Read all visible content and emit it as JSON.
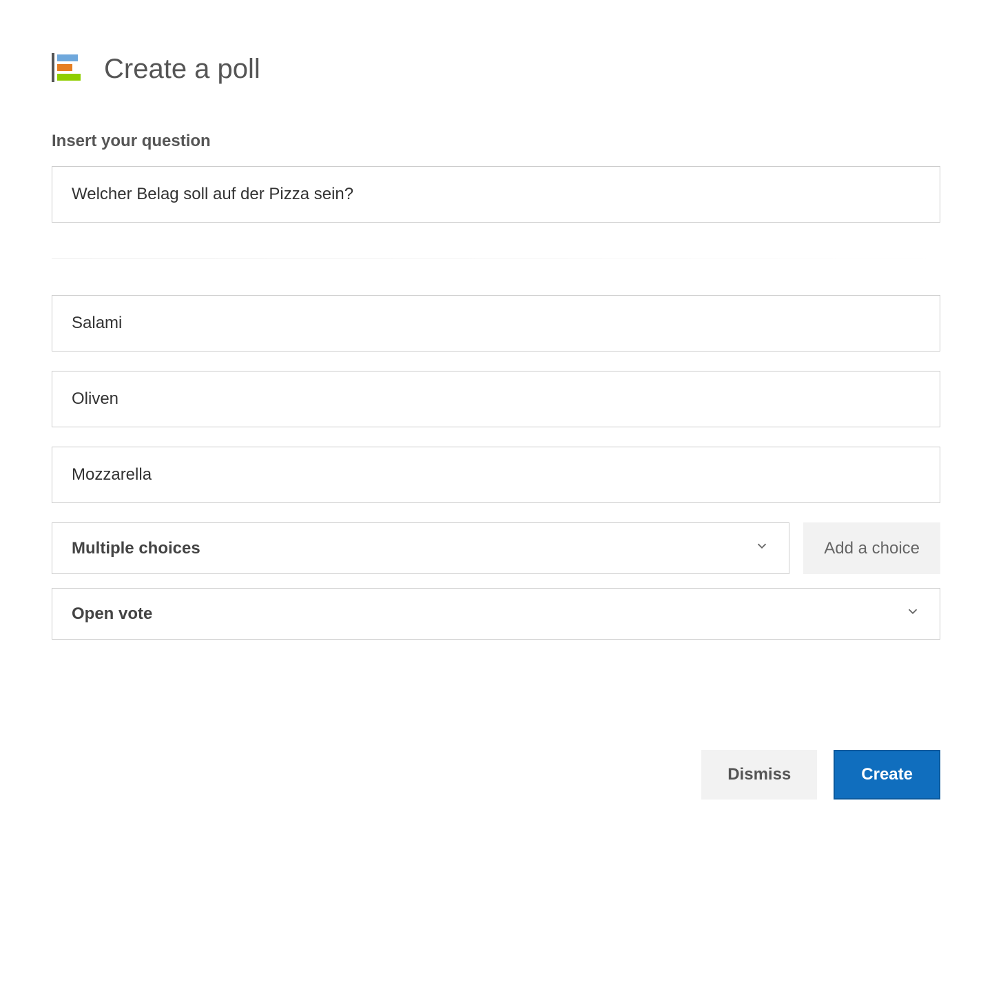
{
  "header": {
    "title": "Create a poll"
  },
  "question": {
    "label": "Insert your question",
    "value": "Welcher Belag soll auf der Pizza sein?"
  },
  "choices": [
    {
      "value": "Salami"
    },
    {
      "value": "Oliven"
    },
    {
      "value": "Mozzarella"
    }
  ],
  "settings": {
    "choice_mode": "Multiple choices",
    "vote_mode": "Open vote"
  },
  "buttons": {
    "add_choice": "Add a choice",
    "dismiss": "Dismiss",
    "create": "Create"
  }
}
